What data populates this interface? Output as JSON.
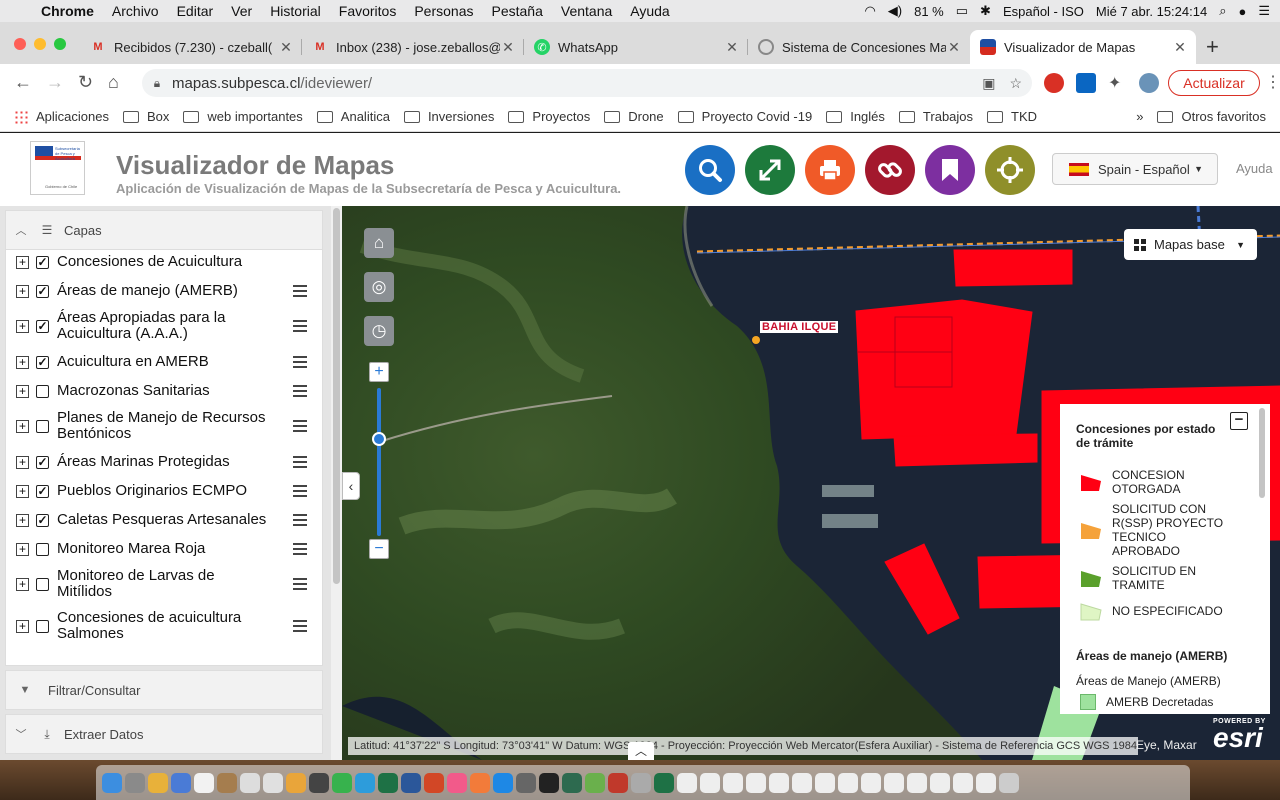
{
  "menubar": {
    "app": "Chrome",
    "items": [
      "Archivo",
      "Editar",
      "Ver",
      "Historial",
      "Favoritos",
      "Personas",
      "Pestaña",
      "Ventana",
      "Ayuda"
    ],
    "battery": "81 %",
    "input_source": "Español - ISO",
    "datetime": "Mié 7 abr.  15:24:14"
  },
  "tabs": [
    {
      "title": "Recibidos (7.230) - czeball(",
      "favicon": "gmail-icon"
    },
    {
      "title": "Inbox (238) - jose.zeballos@",
      "favicon": "gmail-icon"
    },
    {
      "title": "WhatsApp",
      "favicon": "whatsapp-icon"
    },
    {
      "title": "Sistema de Concesiones Ma",
      "favicon": "globe-icon"
    },
    {
      "title": "Visualizador de Mapas",
      "favicon": "chile-logo-icon"
    }
  ],
  "toolbar": {
    "url_host": "mapas.subpesca.cl",
    "url_path": "/ideviewer/",
    "update_label": "Actualizar"
  },
  "bookmarks": {
    "apps_label": "Aplicaciones",
    "folders": [
      "Box",
      "web importantes",
      "Analitica",
      "Inversiones",
      "Proyectos",
      "Drone",
      "Proyecto Covid -19",
      "Inglés",
      "Trabajos",
      "TKD"
    ],
    "overflow": "»",
    "other": "Otros favoritos"
  },
  "header": {
    "title": "Visualizador de Mapas",
    "subtitle": "Aplicación de Visualización de Mapas de la Subsecretaría de Pesca y Acuicultura.",
    "logo_text": [
      "Subsecretaría",
      "de Pesca y",
      "Acuicultura"
    ],
    "logo_footer": "Gobierno de Chile",
    "language": "Spain - Español",
    "help": "Ayuda"
  },
  "colors": {
    "search": "#1a6fc4",
    "expand": "#1d7a3c",
    "print": "#f05a28",
    "link": "#a3182d",
    "bookmark": "#7d2fa0",
    "locate": "#8f8f2a",
    "concession_red": "#ff0013"
  },
  "panel": {
    "layers_title": "Capas",
    "filter_title": "Filtrar/Consultar",
    "extract_title": "Extraer Datos",
    "layers": [
      {
        "label": "Concesiones de Acuicultura",
        "checked": true
      },
      {
        "label": "Áreas de manejo (AMERB)",
        "checked": true
      },
      {
        "label": "Áreas Apropiadas para la Acuicultura (A.A.A.)",
        "checked": true
      },
      {
        "label": "Acuicultura en AMERB",
        "checked": true
      },
      {
        "label": "Macrozonas Sanitarias",
        "checked": false
      },
      {
        "label": "Planes de Manejo de Recursos Bentónicos",
        "checked": false
      },
      {
        "label": "Áreas Marinas Protegidas",
        "checked": true
      },
      {
        "label": "Pueblos Originarios ECMPO",
        "checked": true
      },
      {
        "label": "Caletas Pesqueras Artesanales",
        "checked": true
      },
      {
        "label": "Monitoreo Marea Roja",
        "checked": false
      },
      {
        "label": "Monitoreo de Larvas de Mitílidos",
        "checked": false
      },
      {
        "label": "Concesiones de acuicultura Salmones",
        "checked": false
      }
    ]
  },
  "map": {
    "basemaps_label": "Mapas base",
    "place_label": "BAHIA ILQUE",
    "coords": "Latitud:  41°37'22\" S Longitud:  73°03'41\" W Datum: WGS 1984 - Proyección: Proyección Web Mercator(Esfera Auxiliar) - Sistema de Referencia GCS WGS 1984",
    "attribution": "Eye, Maxar",
    "esri_powered": "POWERED BY",
    "esri": "esri"
  },
  "legend": {
    "heading1": "Concesiones por estado de trámite",
    "items": [
      {
        "label": "CONCESION OTORGADA",
        "color": "#ff0013"
      },
      {
        "label": "SOLICITUD CON R(SSP) PROYECTO TECNICO APROBADO",
        "color": "#f5a23a"
      },
      {
        "label": "SOLICITUD EN TRAMITE",
        "color": "#5aa02c"
      },
      {
        "label": "NO ESPECIFICADO",
        "color": "#dff5c4"
      }
    ],
    "heading2": "Áreas de manejo (AMERB)",
    "sublabel": "Áreas de Manejo (AMERB)",
    "amerb_item": {
      "label": "AMERB Decretadas",
      "color": "#9ee29e"
    }
  }
}
